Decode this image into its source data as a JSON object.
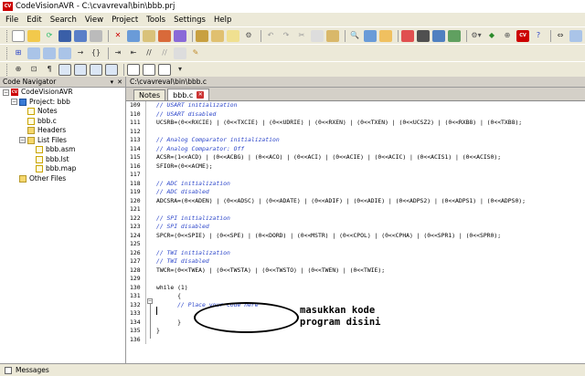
{
  "window": {
    "title": "CodeVisionAVR - C:\\cvavreval\\bin\\bbb.prj",
    "icon": "CV"
  },
  "menu": [
    "File",
    "Edit",
    "Search",
    "View",
    "Project",
    "Tools",
    "Settings",
    "Help"
  ],
  "navigator": {
    "title": "Code Navigator",
    "tree": [
      {
        "label": "CodeVisionAVR",
        "icon": "cv",
        "indent": 0,
        "expander": "-"
      },
      {
        "label": "Project: bbb",
        "icon": "proj",
        "indent": 1,
        "expander": "-"
      },
      {
        "label": "Notes",
        "icon": "doc",
        "indent": 2
      },
      {
        "label": "bbb.c",
        "icon": "doc",
        "indent": 2
      },
      {
        "label": "Headers",
        "icon": "folder",
        "indent": 2
      },
      {
        "label": "List Files",
        "icon": "folder",
        "indent": 2,
        "expander": "-"
      },
      {
        "label": "bbb.asm",
        "icon": "doc",
        "indent": 3
      },
      {
        "label": "bbb.lst",
        "icon": "doc",
        "indent": 3
      },
      {
        "label": "bbb.map",
        "icon": "doc",
        "indent": 3
      },
      {
        "label": "Other Files",
        "icon": "folder",
        "indent": 1
      }
    ]
  },
  "editor": {
    "path": "C:\\cvavreval\\bin\\bbb.c",
    "tabs": [
      {
        "label": "Notes",
        "active": false
      },
      {
        "label": "bbb.c",
        "active": true
      }
    ],
    "lines": [
      {
        "n": "109",
        "t": "// USART initialization",
        "c": true
      },
      {
        "n": "110",
        "t": "// USART disabled",
        "c": true
      },
      {
        "n": "111",
        "t": "UCSRB=(0<<RXCIE) | (0<<TXCIE) | (0<<UDRIE) | (0<<RXEN) | (0<<TXEN) | (0<<UCSZ2) | (0<<RXB8) | (0<<TXB8);",
        "c": false
      },
      {
        "n": "112",
        "t": "",
        "c": false
      },
      {
        "n": "113",
        "t": "// Analog Comparator initialization",
        "c": true
      },
      {
        "n": "114",
        "t": "// Analog Comparator: Off",
        "c": true
      },
      {
        "n": "115",
        "t": "ACSR=(1<<ACD) | (0<<ACBG) | (0<<ACO) | (0<<ACI) | (0<<ACIE) | (0<<ACIC) | (0<<ACIS1) | (0<<ACIS0);",
        "c": false
      },
      {
        "n": "116",
        "t": "SFIOR=(0<<ACME);",
        "c": false
      },
      {
        "n": "117",
        "t": "",
        "c": false
      },
      {
        "n": "118",
        "t": "// ADC initialization",
        "c": true
      },
      {
        "n": "119",
        "t": "// ADC disabled",
        "c": true
      },
      {
        "n": "120",
        "t": "ADCSRA=(0<<ADEN) | (0<<ADSC) | (0<<ADATE) | (0<<ADIF) | (0<<ADIE) | (0<<ADPS2) | (0<<ADPS1) | (0<<ADPS0);",
        "c": false
      },
      {
        "n": "121",
        "t": "",
        "c": false
      },
      {
        "n": "122",
        "t": "// SPI initialization",
        "c": true
      },
      {
        "n": "123",
        "t": "// SPI disabled",
        "c": true
      },
      {
        "n": "124",
        "t": "SPCR=(0<<SPIE) | (0<<SPE) | (0<<DORD) | (0<<MSTR) | (0<<CPOL) | (0<<CPHA) | (0<<SPR1) | (0<<SPR0);",
        "c": false
      },
      {
        "n": "125",
        "t": "",
        "c": false
      },
      {
        "n": "126",
        "t": "// TWI initialization",
        "c": true
      },
      {
        "n": "127",
        "t": "// TWI disabled",
        "c": true
      },
      {
        "n": "128",
        "t": "TWCR=(0<<TWEA) | (0<<TWSTA) | (0<<TWSTO) | (0<<TWEN) | (0<<TWIE);",
        "c": false
      },
      {
        "n": "129",
        "t": "",
        "c": false
      },
      {
        "n": "130",
        "t": "while (1)",
        "c": false
      },
      {
        "n": "131",
        "t": "      {",
        "c": false
      },
      {
        "n": "132",
        "t": "      // Place your code here",
        "c": true
      },
      {
        "n": "133",
        "t": "",
        "c": false
      },
      {
        "n": "134",
        "t": "      }",
        "c": false
      },
      {
        "n": "135",
        "t": "}",
        "c": false
      },
      {
        "n": "136",
        "t": "",
        "c": false
      }
    ]
  },
  "annotation": {
    "line1": "masukkan kode",
    "line2": "program disini"
  },
  "statusbar": {
    "messages_label": "Messages"
  }
}
